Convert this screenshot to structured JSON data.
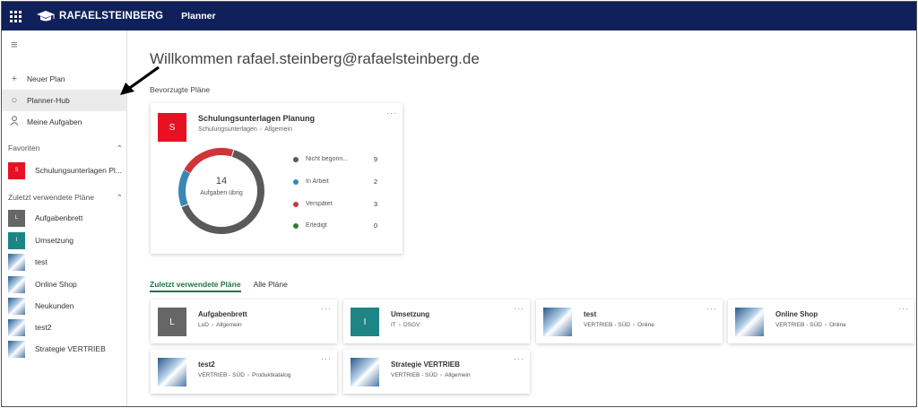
{
  "colors": {
    "topbar": "#10205a",
    "accent_green": "#217346",
    "plan_red": "#e81123",
    "plan_gray": "#666666",
    "plan_teal": "#1e8585"
  },
  "header": {
    "brand": "RAFAELSTEINBERG",
    "app": "Planner",
    "logo_icon": "graduation-cap-icon"
  },
  "sidebar": {
    "nav": [
      {
        "label": "Neuer Plan",
        "icon": "plus-icon"
      },
      {
        "label": "Planner-Hub",
        "icon": "circle-icon"
      },
      {
        "label": "Meine Aufgaben",
        "icon": "person-icon"
      }
    ],
    "favorites_title": "Favoriten",
    "favorites": [
      {
        "label": "Schulungsunterlagen Pl...",
        "badge": "S"
      }
    ],
    "recent_title": "Zuletzt verwendete Pläne",
    "recent": [
      {
        "label": "Aufgabenbrett",
        "badge": "L"
      },
      {
        "label": "Umsetzung",
        "badge": "I"
      },
      {
        "label": "test",
        "badge": ""
      },
      {
        "label": "Online Shop",
        "badge": ""
      },
      {
        "label": "Neukunden",
        "badge": ""
      },
      {
        "label": "test2",
        "badge": ""
      },
      {
        "label": "Strategie VERTRIEB",
        "badge": ""
      }
    ]
  },
  "main": {
    "welcome": "Willkommen rafael.steinberg@rafaelsteinberg.de",
    "favorites_heading": "Bevorzugte Pläne",
    "favorite_card": {
      "badge": "S",
      "title": "Schulungsunterlagen Planung",
      "group": "Schulungsunterlagen",
      "bucket": "Allgemein",
      "remaining_count": "14",
      "remaining_label": "Aufgaben übrig",
      "more": "···",
      "legend": [
        {
          "label": "Nicht begonn...",
          "count": "9",
          "color": "#5a5a5a"
        },
        {
          "label": "In Arbeit",
          "count": "2",
          "color": "#3a87b5"
        },
        {
          "label": "Verspätet",
          "count": "3",
          "color": "#d13438"
        },
        {
          "label": "Erledigt",
          "count": "0",
          "color": "#2f7d32"
        }
      ]
    },
    "tabs": [
      {
        "label": "Zuletzt verwendete Pläne"
      },
      {
        "label": "Alle Pläne"
      }
    ],
    "plans": [
      {
        "title": "Aufgabenbrett",
        "group": "LoD",
        "bucket": "Allgemein",
        "badge": "L",
        "more": "···"
      },
      {
        "title": "Umsetzung",
        "group": "IT",
        "bucket": "DSGV",
        "badge": "I",
        "more": "···"
      },
      {
        "title": "test",
        "group": "VERTRIEB - SÜD",
        "bucket": "Online",
        "badge": "",
        "more": "···"
      },
      {
        "title": "Online Shop",
        "group": "VERTRIEB - SÜD",
        "bucket": "Online",
        "badge": "",
        "more": "···"
      },
      {
        "title": "test2",
        "group": "VERTRIEB - SÜD",
        "bucket": "Produktkatalog",
        "badge": "",
        "more": "···"
      },
      {
        "title": "Strategie VERTRIEB",
        "group": "VERTRIEB - SÜD",
        "bucket": "Allgemein",
        "badge": "",
        "more": "···"
      }
    ]
  }
}
